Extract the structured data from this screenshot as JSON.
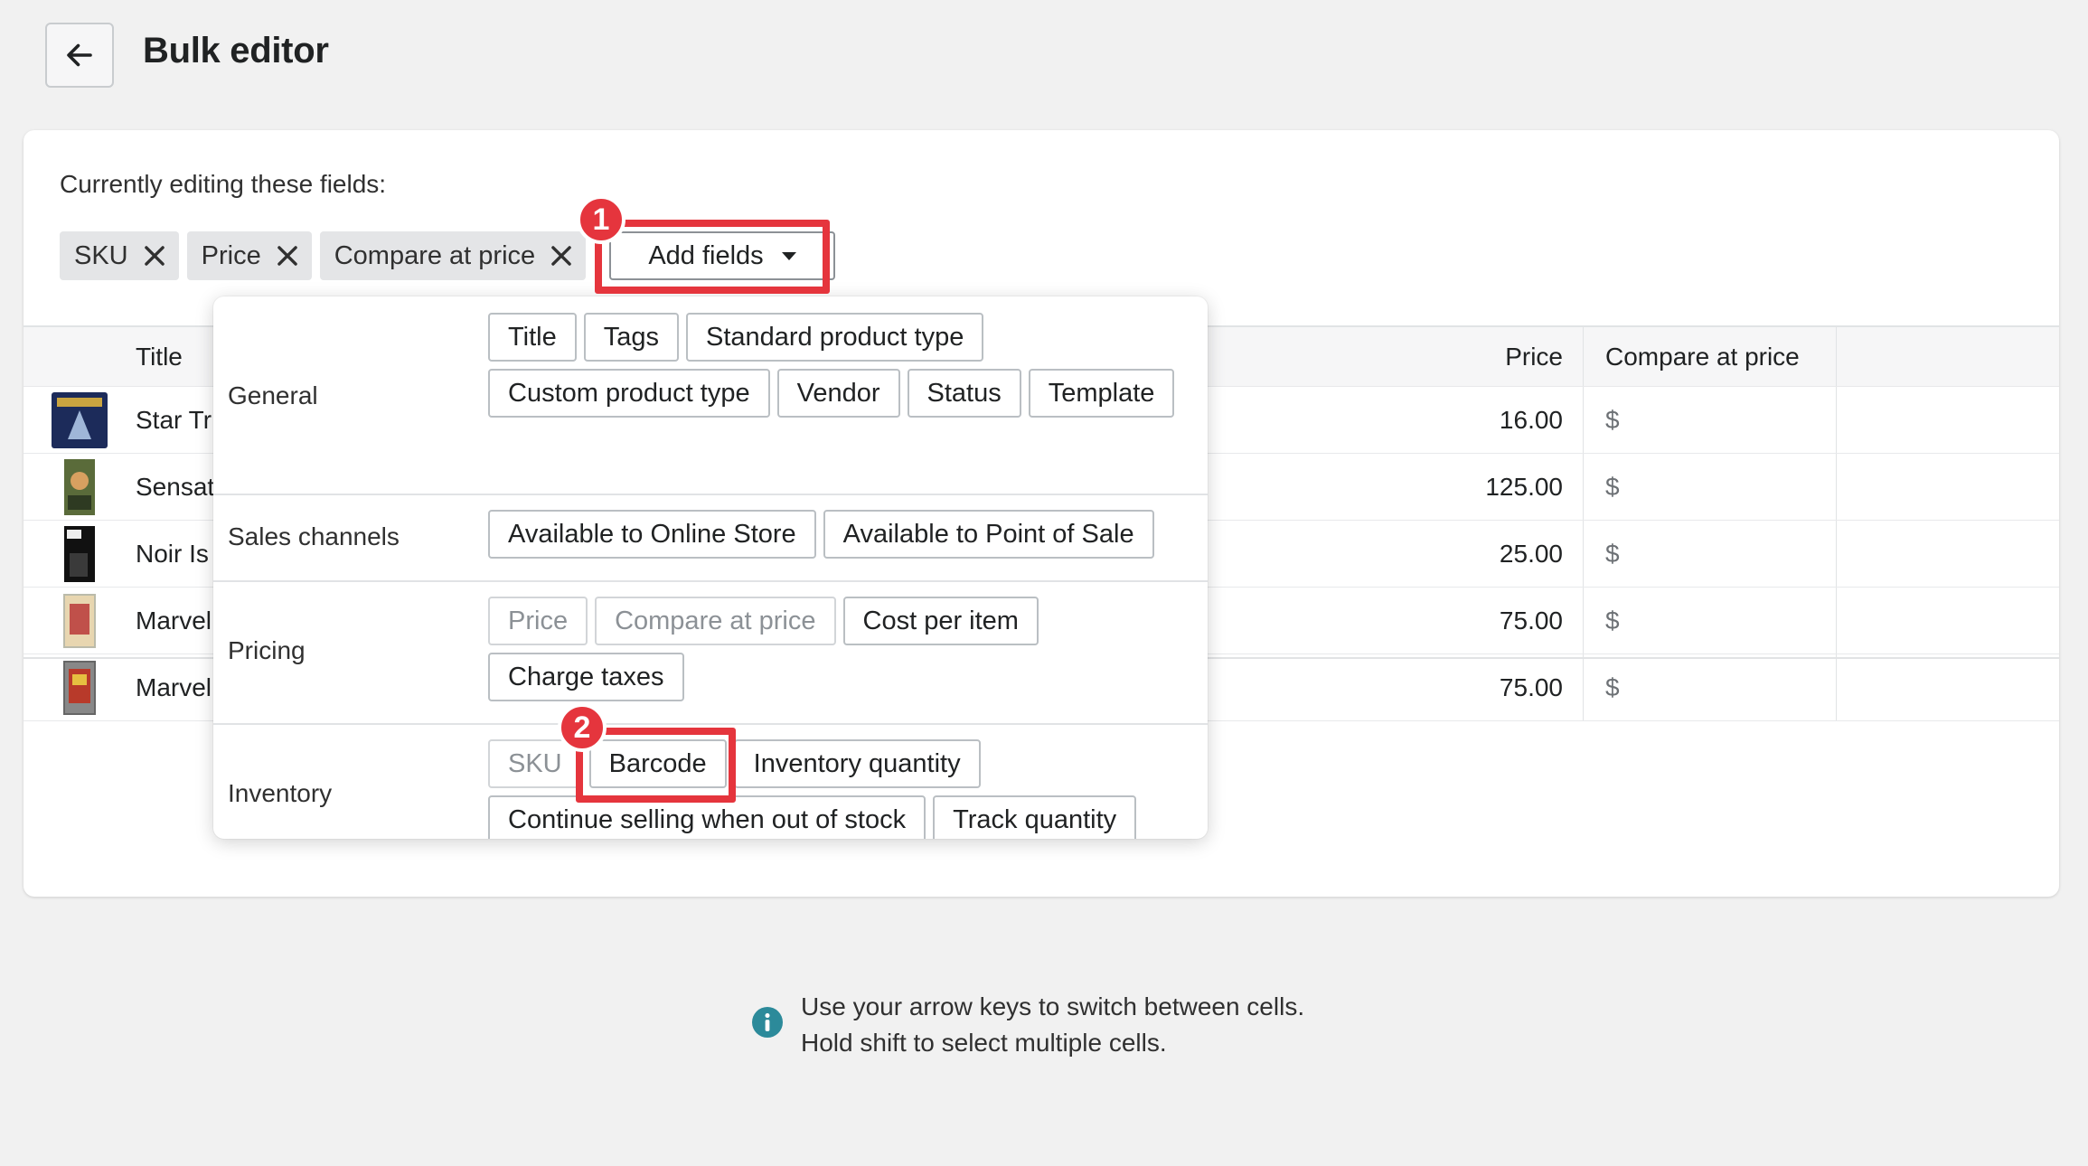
{
  "header": {
    "title": "Bulk editor"
  },
  "editing": {
    "label": "Currently editing these fields:",
    "chips": [
      {
        "label": "SKU"
      },
      {
        "label": "Price"
      },
      {
        "label": "Compare at price"
      }
    ],
    "add_fields_label": "Add fields"
  },
  "grid": {
    "columns": {
      "title": "Title",
      "price": "Price",
      "compare": "Compare at price"
    },
    "rows": [
      {
        "title": "Star Tr",
        "price": "16.00",
        "compare": "$"
      },
      {
        "title": "Sensat",
        "price": "125.00",
        "compare": "$"
      },
      {
        "title": "Noir Is",
        "price": "25.00",
        "compare": "$"
      },
      {
        "title": "Marvel",
        "price": "75.00",
        "compare": "$"
      },
      {
        "title": "Marvel",
        "price": "75.00",
        "compare": "$"
      }
    ]
  },
  "popover": {
    "sections": [
      {
        "label": "General",
        "options": [
          {
            "label": "Title",
            "disabled": false
          },
          {
            "label": "Tags",
            "disabled": false
          },
          {
            "label": "Standard product type",
            "disabled": false
          },
          {
            "label": "Custom product type",
            "disabled": false
          },
          {
            "label": "Vendor",
            "disabled": false
          },
          {
            "label": "Status",
            "disabled": false
          },
          {
            "label": "Template",
            "disabled": false
          }
        ]
      },
      {
        "label": "Sales channels",
        "options": [
          {
            "label": "Available to Online Store",
            "disabled": false
          },
          {
            "label": "Available to Point of Sale",
            "disabled": false
          }
        ]
      },
      {
        "label": "Pricing",
        "options": [
          {
            "label": "Price",
            "disabled": true
          },
          {
            "label": "Compare at price",
            "disabled": true
          },
          {
            "label": "Cost per item",
            "disabled": false
          },
          {
            "label": "Charge taxes",
            "disabled": false
          }
        ]
      },
      {
        "label": "Inventory",
        "options": [
          {
            "label": "SKU",
            "disabled": true
          },
          {
            "label": "Barcode",
            "disabled": false
          },
          {
            "label": "Inventory quantity",
            "disabled": false
          },
          {
            "label": "Continue selling when out of stock",
            "disabled": false
          },
          {
            "label": "Track quantity",
            "disabled": false
          }
        ]
      }
    ]
  },
  "annotations": {
    "step1": "1",
    "step2": "2",
    "color": "#e5353d"
  },
  "info": {
    "line1": "Use your arrow keys to switch between cells.",
    "line2": "Hold shift to select multiple cells.",
    "icon_color": "#2c8a9a"
  }
}
